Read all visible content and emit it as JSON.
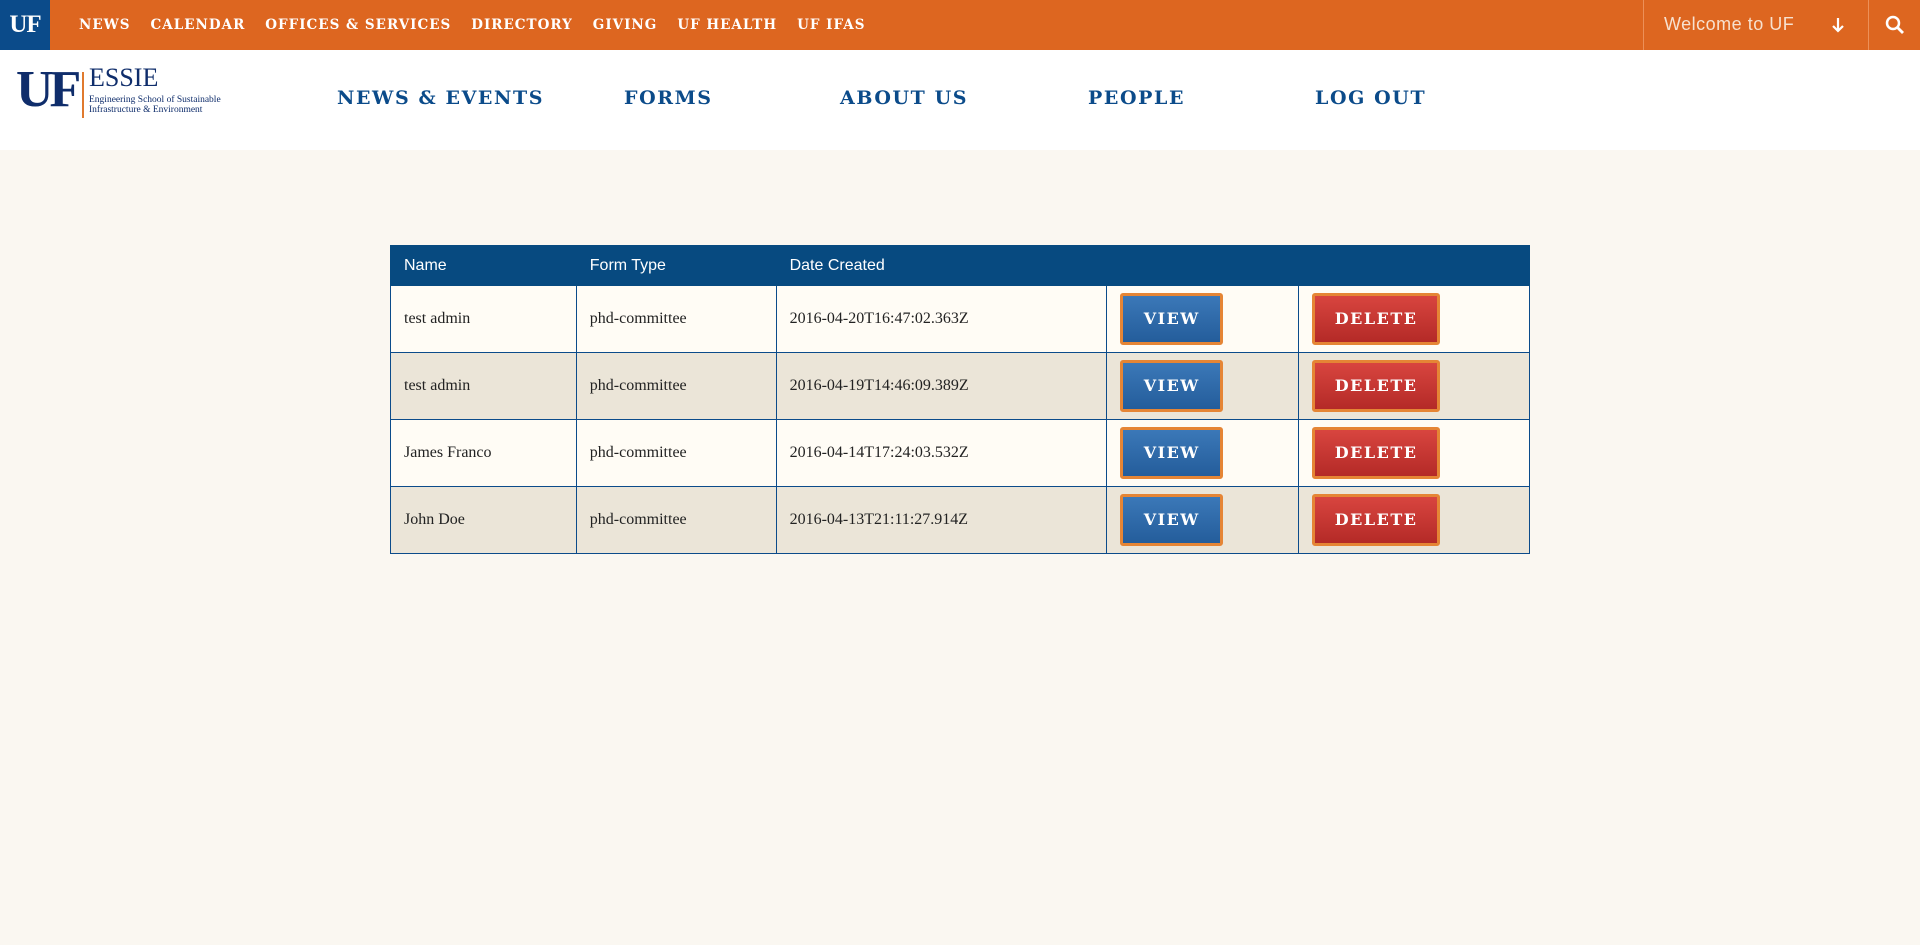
{
  "topbar": {
    "badge": "UF",
    "nav": [
      "NEWS",
      "CALENDAR",
      "OFFICES & SERVICES",
      "DIRECTORY",
      "GIVING",
      "UF HEALTH",
      "UF IFAS"
    ],
    "welcome": "Welcome to UF",
    "colors": {
      "bar": "#dd6620",
      "badge": "#0b4b8a"
    }
  },
  "logo": {
    "mark": "UF",
    "name": "ESSIE",
    "subtitle_line1": "Engineering School of Sustainable",
    "subtitle_line2": "Infrastructure & Environment"
  },
  "mainnav": {
    "news_events": "NEWS & EVENTS",
    "forms": "FORMS",
    "about_us": "ABOUT US",
    "people": "PEOPLE",
    "log_out": "LOG OUT"
  },
  "table": {
    "headers": [
      "Name",
      "Form Type",
      "Date Created",
      "",
      ""
    ],
    "view_label": "VIEW",
    "delete_label": "DELETE",
    "rows": [
      {
        "name": "test admin",
        "form_type": "phd-committee",
        "date_created": "2016-04-20T16:47:02.363Z"
      },
      {
        "name": "test admin",
        "form_type": "phd-committee",
        "date_created": "2016-04-19T14:46:09.389Z"
      },
      {
        "name": "James Franco",
        "form_type": "phd-committee",
        "date_created": "2016-04-14T17:24:03.532Z"
      },
      {
        "name": "John Doe",
        "form_type": "phd-committee",
        "date_created": "2016-04-13T21:11:27.914Z"
      }
    ]
  },
  "icons": {
    "welcome_dropdown": "arrow-down-icon",
    "search": "search-icon"
  }
}
